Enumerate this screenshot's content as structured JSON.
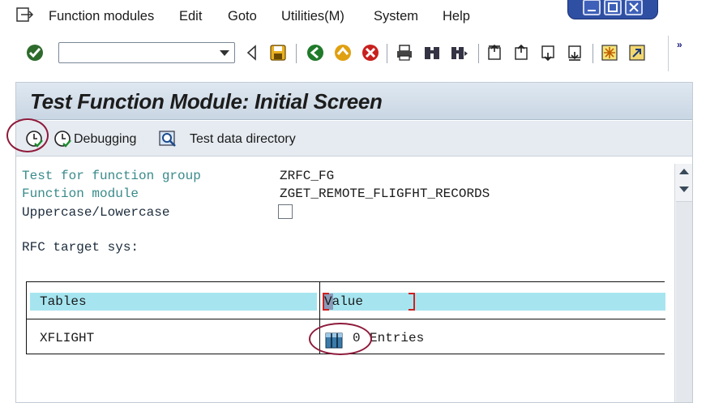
{
  "menu": {
    "items": [
      "Function modules",
      "Edit",
      "Goto",
      "Utilities(M)",
      "System",
      "Help"
    ]
  },
  "toolbar": {
    "command_value": "",
    "more": "»"
  },
  "screen": {
    "title": "Test Function Module: Initial Screen",
    "buttons": {
      "debugging": "Debugging",
      "test_data_directory": "Test data directory"
    }
  },
  "form": {
    "function_group_label": "Test for function group",
    "function_group_value": "ZRFC_FG",
    "function_module_label": "Function module",
    "function_module_value": "ZGET_REMOTE_FLIGFHT_RECORDS",
    "case_label": "Uppercase/Lowercase",
    "case_checked": false,
    "rfc_label": "RFC target sys:",
    "rfc_value": ""
  },
  "table": {
    "headers": [
      "Tables",
      "Value"
    ],
    "rows": [
      {
        "name": "XFLIGHT",
        "count": "0",
        "unit": "Entries"
      }
    ]
  },
  "colors": {
    "title_bar": "#d4dfea",
    "table_header": "#a6e5f0",
    "annotation": "#8e1a3a",
    "window_controls": "#2f4fa3"
  }
}
